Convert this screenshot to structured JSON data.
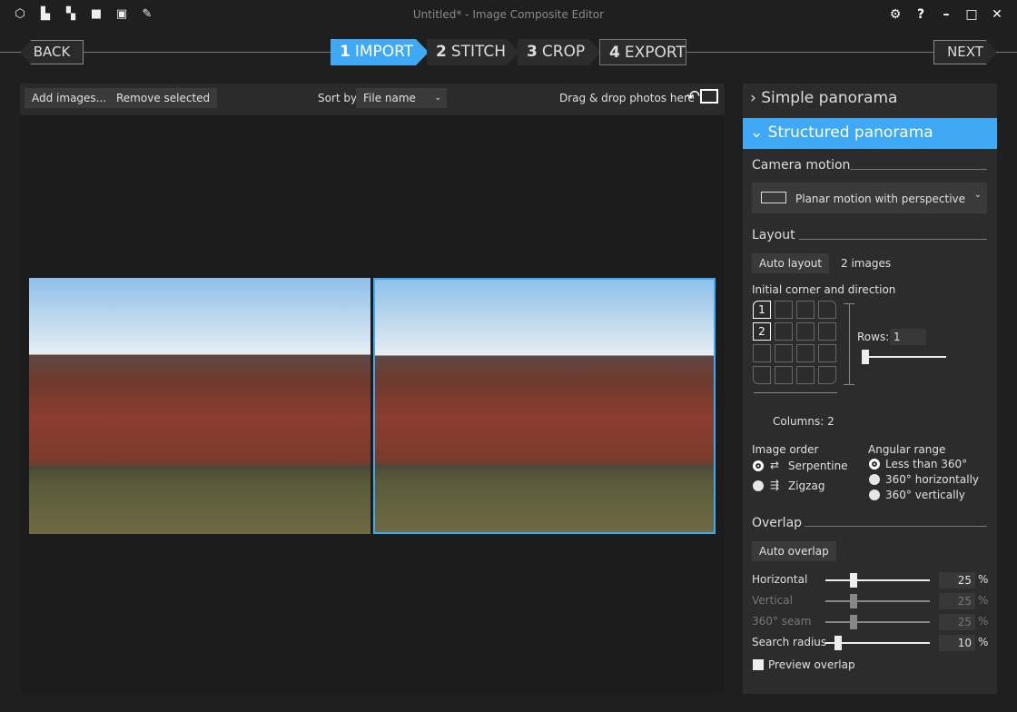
{
  "window": {
    "title": "Untitled* - Image Composite Editor",
    "toolbar_icons": [
      "new-project-icon",
      "new-panorama-from-images-icon",
      "new-panorama-from-video-icon",
      "open-project-icon",
      "save-project-icon",
      "export-icon"
    ],
    "controls": [
      "settings-icon",
      "help-icon",
      "minimize-icon",
      "maximize-icon",
      "close-icon"
    ]
  },
  "nav": {
    "back": "BACK",
    "next": "NEXT",
    "steps": [
      {
        "num": "1",
        "label": "IMPORT",
        "active": true
      },
      {
        "num": "2",
        "label": "STITCH"
      },
      {
        "num": "3",
        "label": "CROP"
      },
      {
        "num": "4",
        "label": "EXPORT"
      }
    ],
    "accent": "#3fa9f5"
  },
  "toolbar": {
    "add_images": "Add images...",
    "remove_selected": "Remove selected",
    "sort_by_label": "Sort by",
    "sort_by_value": "File name",
    "drag_drop": "Drag & drop photos here"
  },
  "images": [
    {
      "selected": false
    },
    {
      "selected": true
    }
  ],
  "panel": {
    "simple": "Simple panorama",
    "structured": "Structured panorama",
    "camera_motion": {
      "title": "Camera motion",
      "value": "Planar motion with perspective"
    },
    "layout": {
      "title": "Layout",
      "auto_layout": "Auto layout",
      "image_count": "2 images",
      "corner_label": "Initial corner and direction",
      "rows_label": "Rows:",
      "rows_value": "1",
      "rows_slider": 1,
      "columns_label": "Columns:",
      "columns_value": "2",
      "cell1": "1",
      "cell2": "2"
    },
    "image_order": {
      "title": "Image order",
      "options": [
        "Serpentine",
        "Zigzag"
      ],
      "selected": "Serpentine"
    },
    "angular_range": {
      "title": "Angular range",
      "options": [
        "Less than 360°",
        "360° horizontally",
        "360° vertically"
      ],
      "selected": "Less than 360°"
    },
    "overlap": {
      "title": "Overlap",
      "auto_overlap": "Auto overlap",
      "unit": "%",
      "sliders": [
        {
          "label": "Horizontal",
          "value": "25",
          "enabled": true
        },
        {
          "label": "Vertical",
          "value": "25",
          "enabled": false
        },
        {
          "label": "360° seam",
          "value": "25",
          "enabled": false
        },
        {
          "label": "Search radius",
          "value": "10",
          "enabled": true
        }
      ],
      "preview": "Preview overlap",
      "preview_checked": false
    }
  }
}
